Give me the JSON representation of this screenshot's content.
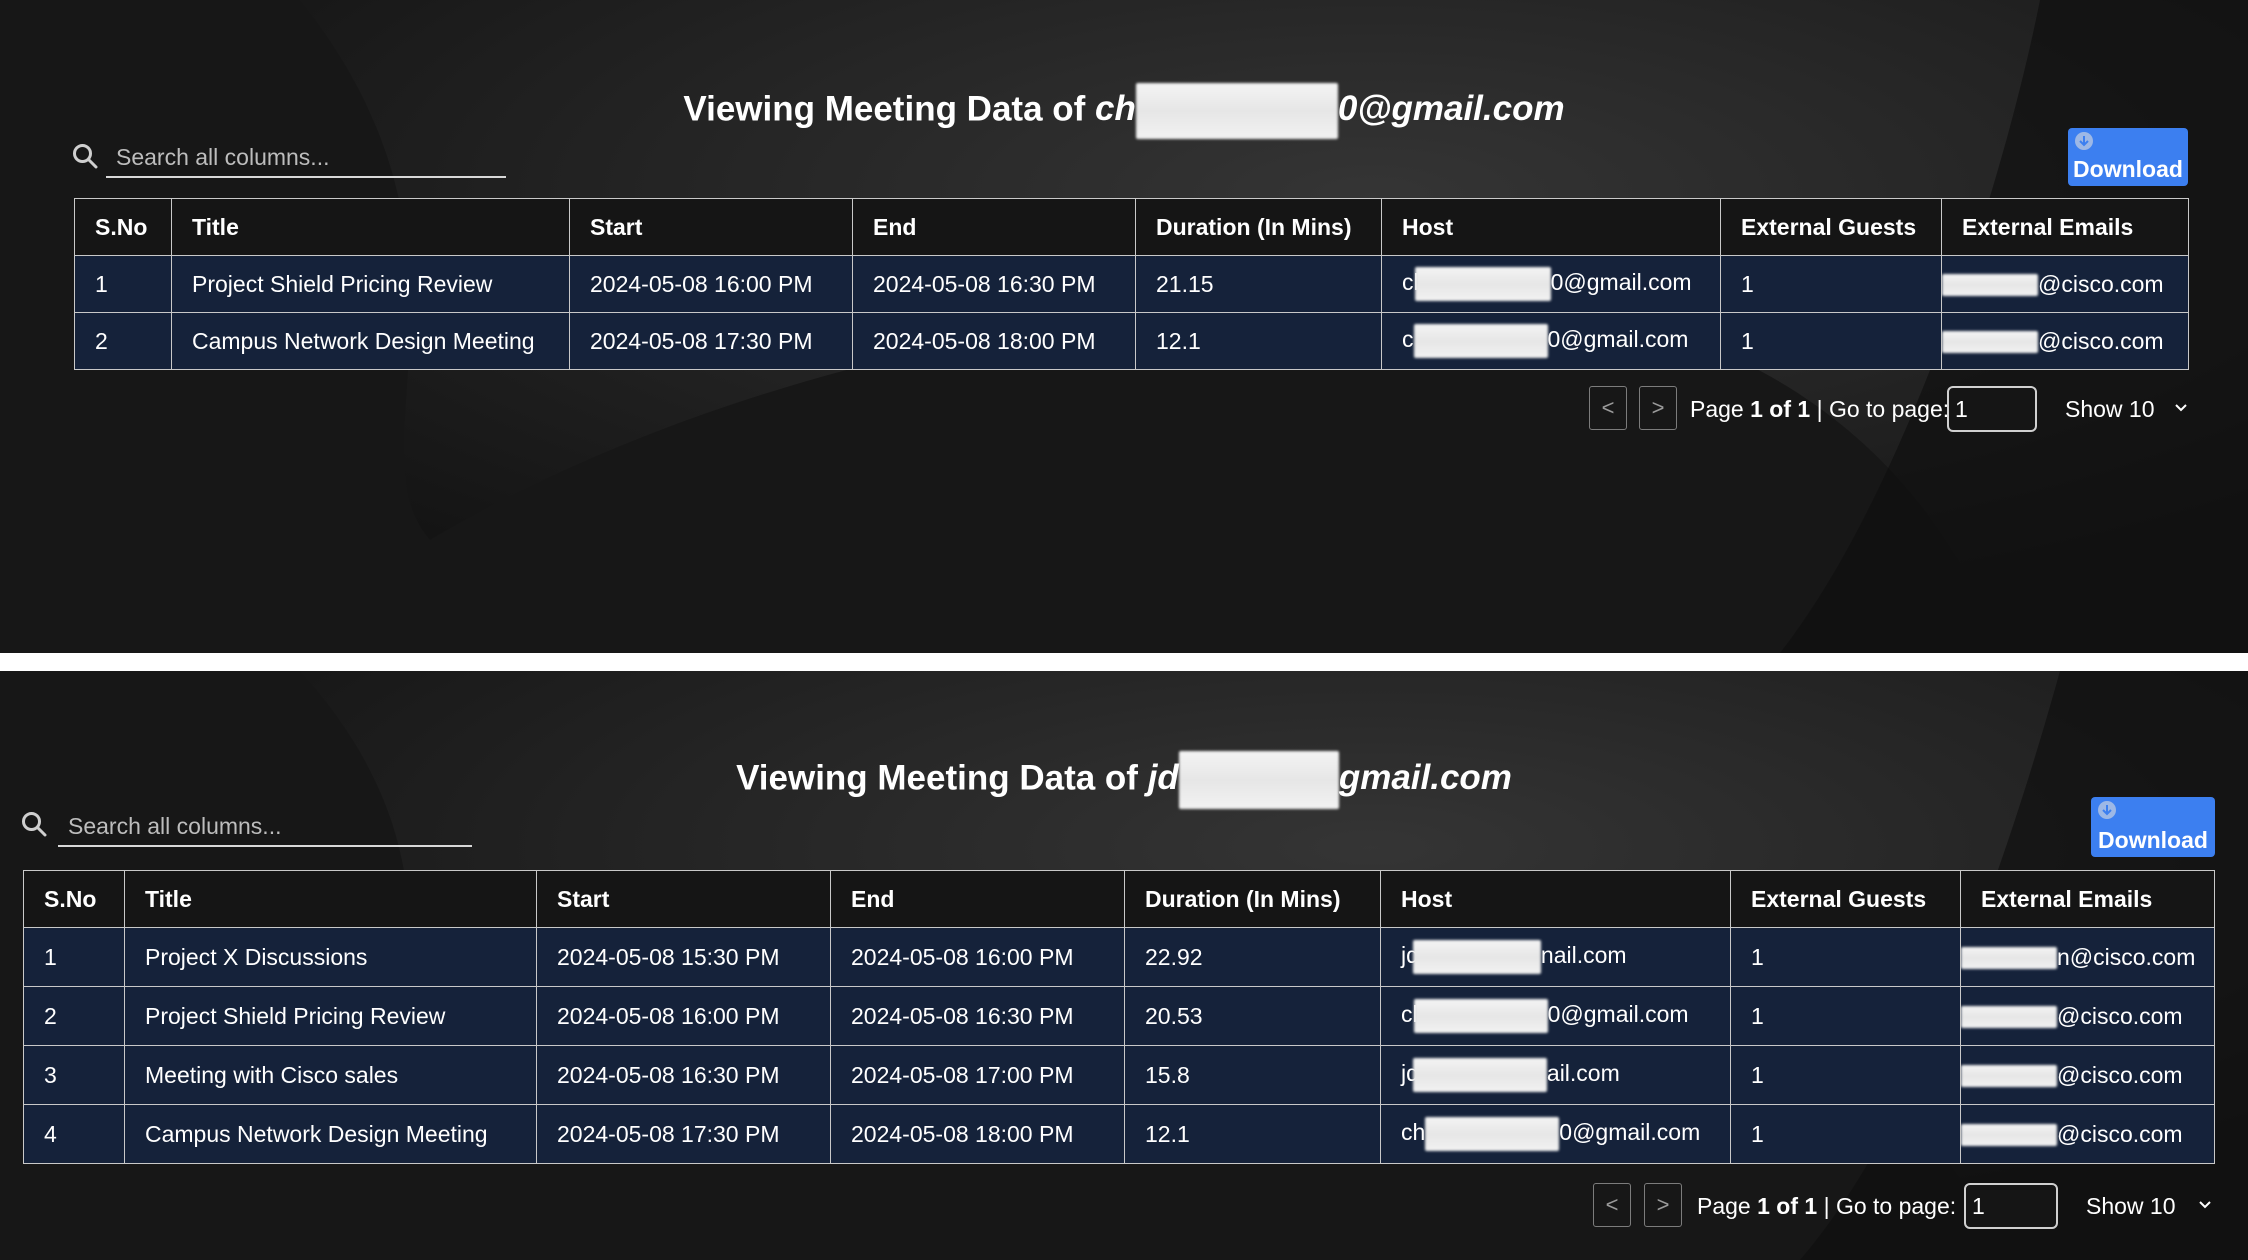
{
  "panels": [
    {
      "title_prefix": "Viewing Meeting Data of",
      "email_start": "ch",
      "email_end": "0@gmail.com",
      "search_placeholder": "Search all columns...",
      "download_label": "Download",
      "columns": [
        "S.No",
        "Title",
        "Start",
        "End",
        "Duration (In Mins)",
        "Host",
        "External Guests",
        "External Emails"
      ],
      "rows": [
        {
          "sno": "1",
          "title": "Project Shield Pricing Review",
          "start": "2024-05-08 16:00 PM",
          "end": "2024-05-08 16:30 PM",
          "duration": "21.15",
          "host_start": "cl",
          "host_end": "0@gmail.com",
          "guests": "1",
          "emails_end": "@cisco.com"
        },
        {
          "sno": "2",
          "title": "Campus Network Design Meeting",
          "start": "2024-05-08 17:30 PM",
          "end": "2024-05-08 18:00 PM",
          "duration": "12.1",
          "host_start": "c",
          "host_end": "0@gmail.com",
          "guests": "1",
          "emails_end": "@cisco.com"
        }
      ],
      "pager": {
        "prev": "<",
        "next": ">",
        "page_word": "Page",
        "page_bold": "1 of 1",
        "goto": "| Go to page:",
        "goto_value": "1",
        "show": "Show 10"
      }
    },
    {
      "title_prefix": "Viewing Meeting Data of",
      "email_start": "jd",
      "email_end": "gmail.com",
      "search_placeholder": "Search all columns...",
      "download_label": "Download",
      "columns": [
        "S.No",
        "Title",
        "Start",
        "End",
        "Duration (In Mins)",
        "Host",
        "External Guests",
        "External Emails"
      ],
      "rows": [
        {
          "sno": "1",
          "title": "Project X Discussions",
          "start": "2024-05-08 15:30 PM",
          "end": "2024-05-08 16:00 PM",
          "duration": "22.92",
          "host_start": "jd",
          "host_end": "nail.com",
          "guests": "1",
          "emails_end": "n@cisco.com"
        },
        {
          "sno": "2",
          "title": "Project Shield Pricing Review",
          "start": "2024-05-08 16:00 PM",
          "end": "2024-05-08 16:30 PM",
          "duration": "20.53",
          "host_start": "cl",
          "host_end": "0@gmail.com",
          "guests": "1",
          "emails_end": "@cisco.com"
        },
        {
          "sno": "3",
          "title": "Meeting with Cisco sales",
          "start": "2024-05-08 16:30 PM",
          "end": "2024-05-08 17:00 PM",
          "duration": "15.8",
          "host_start": "jd",
          "host_end": "ail.com",
          "guests": "1",
          "emails_end": "@cisco.com"
        },
        {
          "sno": "4",
          "title": "Campus Network Design Meeting",
          "start": "2024-05-08 17:30 PM",
          "end": "2024-05-08 18:00 PM",
          "duration": "12.1",
          "host_start": "ch",
          "host_end": "0@gmail.com",
          "guests": "1",
          "emails_end": "@cisco.com"
        }
      ],
      "pager": {
        "prev": "<",
        "next": ">",
        "page_word": "Page",
        "page_bold": "1 of 1",
        "goto": "| Go to page:",
        "goto_value": "1",
        "show": "Show 10"
      }
    }
  ],
  "colors": {
    "panel_bg": "#151515",
    "row_bg": "#15223a",
    "accent": "#3c7ff0",
    "border": "#c9c9c9"
  },
  "icons": {
    "search": "search-icon",
    "download": "download-icon",
    "dropdown": "chevron-down-icon"
  }
}
